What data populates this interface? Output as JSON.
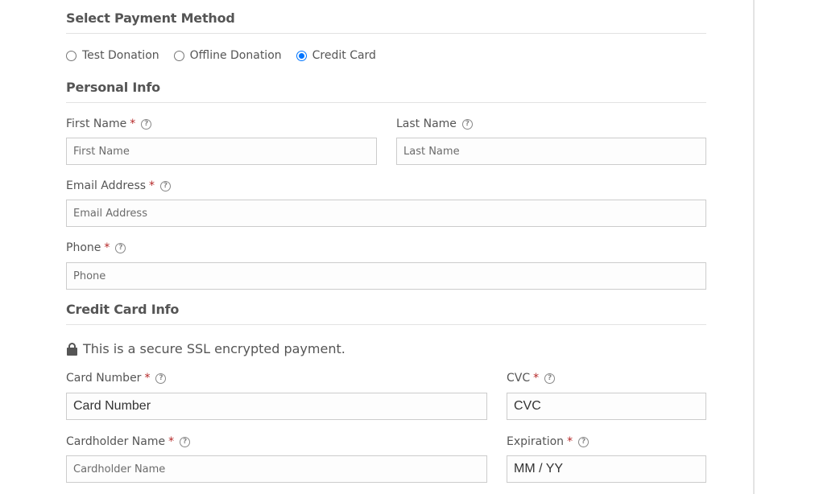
{
  "payment_method": {
    "title": "Select Payment Method",
    "options": [
      {
        "label": "Test Donation",
        "checked": false
      },
      {
        "label": "Offline Donation",
        "checked": false
      },
      {
        "label": "Credit Card",
        "checked": true
      }
    ]
  },
  "personal_info": {
    "title": "Personal Info",
    "first_name": {
      "label": "First Name",
      "required": "*",
      "placeholder": "First Name"
    },
    "last_name": {
      "label": "Last Name",
      "placeholder": "Last Name"
    },
    "email": {
      "label": "Email Address",
      "required": "*",
      "placeholder": "Email Address"
    },
    "phone": {
      "label": "Phone",
      "required": "*",
      "placeholder": "Phone"
    }
  },
  "credit_card": {
    "title": "Credit Card Info",
    "secure_notice": "This is a secure SSL encrypted payment.",
    "card_number": {
      "label": "Card Number",
      "required": "*",
      "placeholder": "Card Number"
    },
    "cvc": {
      "label": "CVC",
      "required": "*",
      "placeholder": "CVC"
    },
    "cardholder_name": {
      "label": "Cardholder Name",
      "required": "*",
      "placeholder": "Cardholder Name"
    },
    "expiration": {
      "label": "Expiration",
      "required": "*",
      "placeholder": "MM / YY"
    }
  },
  "help_glyph": "?",
  "colors": {
    "accent": "#0075ff",
    "required": "#b52727"
  }
}
